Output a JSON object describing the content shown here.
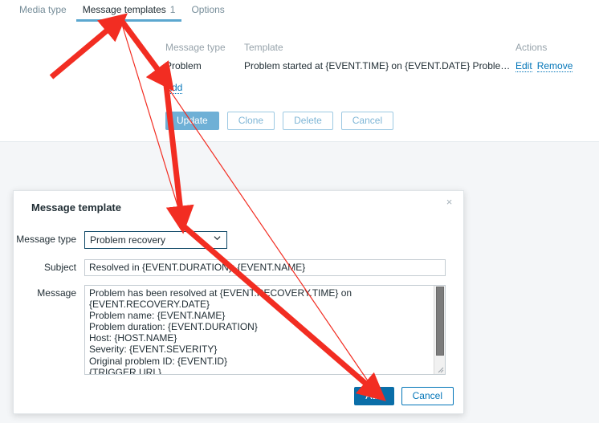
{
  "tabs": [
    {
      "label": "Media type",
      "badge": "",
      "selected": false
    },
    {
      "label": "Message templates",
      "badge": "1",
      "selected": true
    },
    {
      "label": "Options",
      "badge": "",
      "selected": false
    }
  ],
  "templates_table": {
    "headers": {
      "message_type": "Message type",
      "template": "Template",
      "actions": "Actions"
    },
    "rows": [
      {
        "message_type": "Problem",
        "template": "Problem started at {EVENT.TIME} on {EVENT.DATE} Proble…",
        "edit": "Edit",
        "remove": "Remove"
      }
    ],
    "add_link": "Add"
  },
  "form_buttons": {
    "update": "Update",
    "clone": "Clone",
    "delete": "Delete",
    "cancel": "Cancel"
  },
  "dialog": {
    "title": "Message template",
    "close": "×",
    "fields": {
      "message_type_label": "Message type",
      "message_type_value": "Problem recovery",
      "subject_label": "Subject",
      "subject_value": "Resolved in {EVENT.DURATION}: {EVENT.NAME}",
      "message_label": "Message",
      "message_value": "Problem has been resolved at {EVENT.RECOVERY.TIME} on {EVENT.RECOVERY.DATE}\nProblem name: {EVENT.NAME}\nProblem duration: {EVENT.DURATION}\nHost: {HOST.NAME}\nSeverity: {EVENT.SEVERITY}\nOriginal problem ID: {EVENT.ID}\n{TRIGGER.URL}"
    },
    "footer": {
      "add": "Add",
      "cancel": "Cancel"
    }
  },
  "colors": {
    "accent": "#0275b8",
    "primary_button": "#0a6ea8",
    "tab_underline": "#5ba7cf",
    "annotation_arrow": "#f22d22",
    "muted_text": "#97a3ab"
  },
  "annotations": {
    "arrow_1": "arrow pointing to Message templates tab",
    "arrow_2": "arrow pointing to Add link",
    "arrow_3": "arrow from Add link down to dialog",
    "arrow_4": "arrow pointing to dialog Add button"
  }
}
